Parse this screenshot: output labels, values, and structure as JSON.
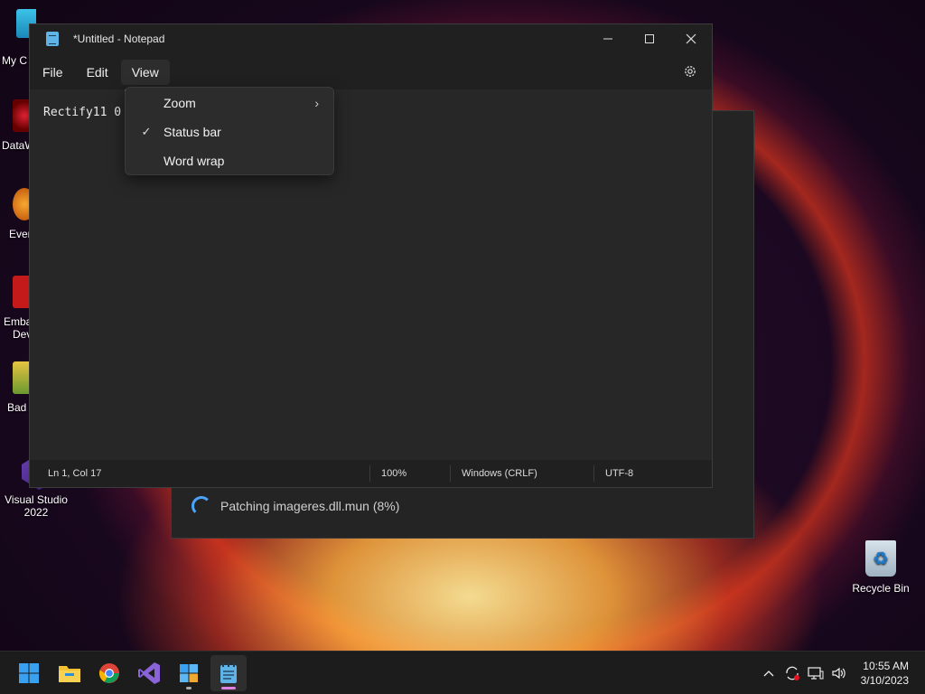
{
  "desktop": {
    "icons_left": [
      {
        "label": "My C",
        "name": "my-computer"
      },
      {
        "label": "DataW",
        "name": "dataw"
      },
      {
        "label": "Ever",
        "name": "ever"
      },
      {
        "label": "Emba",
        "label2": "Dev",
        "name": "embarcadero-dev"
      },
      {
        "label": "Bad",
        "name": "bad"
      }
    ],
    "visual_studio": {
      "line1": "Visual Studio",
      "line2": "2022"
    },
    "recycle_bin": {
      "label": "Recycle Bin"
    }
  },
  "installer": {
    "status_text": "Patching imageres.dll.mun (8%)"
  },
  "notepad": {
    "title": "*Untitled - Notepad",
    "menus": [
      "File",
      "Edit",
      "View"
    ],
    "editor_text": "Rectify11 0",
    "status": {
      "position": "Ln 1, Col 17",
      "zoom": "100%",
      "line_ending": "Windows (CRLF)",
      "encoding": "UTF-8"
    }
  },
  "view_menu": {
    "items": [
      {
        "label": "Zoom",
        "has_submenu": true,
        "checked": false
      },
      {
        "label": "Status bar",
        "has_submenu": false,
        "checked": true
      },
      {
        "label": "Word wrap",
        "has_submenu": false,
        "checked": false
      }
    ]
  },
  "taskbar": {
    "apps": [
      "start",
      "file-explorer",
      "chrome",
      "visual-studio",
      "rectify11-installer",
      "notepad"
    ],
    "time": "10:55 AM",
    "date": "3/10/2023"
  },
  "colors": {
    "accent": "#4aa3ff",
    "notepad_indicator": "#e080e0"
  }
}
